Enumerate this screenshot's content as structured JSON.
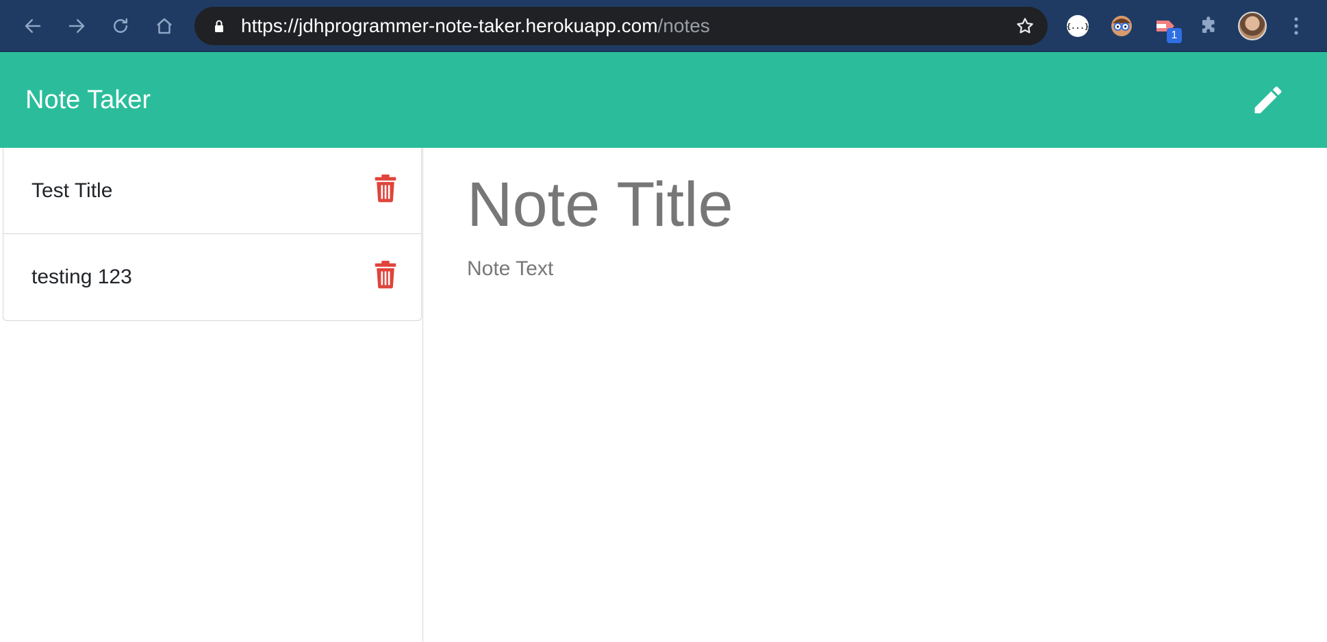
{
  "browser": {
    "url_host": "https://jdhprogrammer-note-taker.herokuapp.com",
    "url_path": "/notes",
    "extensions": [
      {
        "icon": "json-formatter-icon",
        "label": "{...}"
      },
      {
        "icon": "nerd-glasses-icon"
      },
      {
        "icon": "flag-extension-icon",
        "badge": "1"
      },
      {
        "icon": "puzzle-icon"
      }
    ]
  },
  "header": {
    "brand": "Note Taker",
    "new_note_icon": "pencil-icon",
    "accent_color": "#2bbd9b"
  },
  "notes": [
    {
      "title": "Test Title",
      "delete_icon": "trash-icon"
    },
    {
      "title": "testing 123",
      "delete_icon": "trash-icon"
    }
  ],
  "editor": {
    "title_placeholder": "Note Title",
    "text_placeholder": "Note Text"
  },
  "colors": {
    "delete": "#e0443b",
    "chrome": "#1f3b63"
  }
}
